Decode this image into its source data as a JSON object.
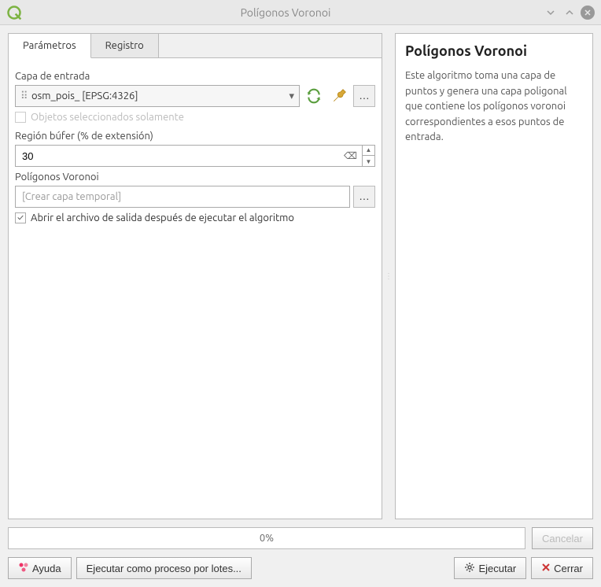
{
  "window": {
    "title": "Polígonos Voronoi"
  },
  "tabs": {
    "params": "Parámetros",
    "log": "Registro"
  },
  "params": {
    "input_label": "Capa de entrada",
    "input_value": "osm_pois_ [EPSG:4326]",
    "selected_only": "Objetos seleccionados solamente",
    "buffer_label": "Región búfer (% de extensión)",
    "buffer_value": "30",
    "output_label": "Polígonos Voronoi",
    "output_placeholder": "[Crear capa temporal]",
    "open_after": "Abrir el archivo de salida después de ejecutar el algoritmo"
  },
  "help": {
    "title": "Polígonos Voronoi",
    "body": "Este algoritmo toma una capa de puntos y genera una capa poligonal que contiene los polígonos voronoi correspondientes a esos puntos de entrada."
  },
  "progress": {
    "text": "0%"
  },
  "buttons": {
    "cancel": "Cancelar",
    "help": "Ayuda",
    "batch": "Ejecutar como proceso por lotes...",
    "run": "Ejecutar",
    "close": "Cerrar"
  }
}
